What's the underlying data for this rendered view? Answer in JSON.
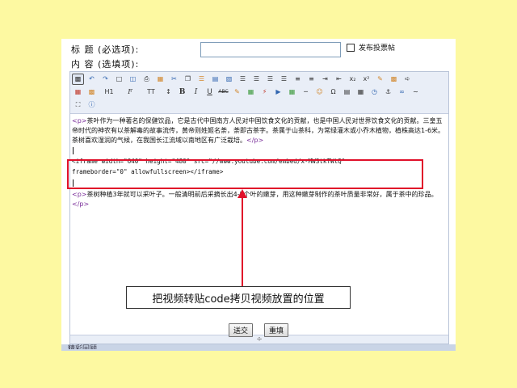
{
  "form": {
    "title_label": "标  题 (必选项):",
    "content_label": "内  容 (选填项):",
    "title_value": "",
    "poll_label": "发布投票帖"
  },
  "toolbar": {
    "row1": [
      "source",
      "undo",
      "redo",
      "new",
      "preview",
      "print",
      "template",
      "cut",
      "copy",
      "paste",
      "paste-text",
      "paste-word",
      "align-left",
      "align-center",
      "align-right",
      "justify",
      "ordered-list",
      "unordered-list",
      "indent",
      "outdent",
      "subscript",
      "superscript",
      "clear-format",
      "select-all",
      "select"
    ],
    "row2_text": {
      "h1": "H1",
      "font": "F",
      "size": "TT",
      "bold": "B",
      "italic": "I",
      "underline": "U",
      "strike": "ABC"
    },
    "row2_icons": [
      "text-color",
      "bg-color",
      "h1",
      "font-family",
      "font-size",
      "bold",
      "italic",
      "underline",
      "strikethrough",
      "line-height",
      "remove-format",
      "image",
      "flash",
      "media",
      "table",
      "hr",
      "emoticon",
      "special-char",
      "page-break",
      "date",
      "time",
      "anchor",
      "link",
      "unlink"
    ],
    "row3_icons": [
      "fullscreen",
      "about"
    ]
  },
  "editor": {
    "para1_open": "<p>",
    "para1_text": "茶叶作为一种著名的保健饮品，它是古代中国南方人民对中国饮食文化的贡献，也是中国人民对世界饮食文化的贡献。三皇五帝时代的神农有以茶解毒的故事流传，黄帝则姓姬名荼，荼即古茶字。茶属于山茶科，为常绿灌木或小乔木植物，植株高达1-6米。茶树喜欢湿润的气候，在我国长江流域以南地区有广泛栽培。",
    "para1_close": "</p>",
    "code_line1": "<iframe width=\"640\" height=\"480\" src=\"//www.youtube.com/embed/x-MWStkTWtQ\"",
    "code_line2": "frameborder=\"0\" allowfullscreen></iframe>",
    "para2_open": "<p>",
    "para2_text": "茶树种植3年就可以采叶子。一般清明前后采摘长出4-5个叶的嫩芽，用这种嫩芽制作的茶叶质量非常好，属于茶中的珍品。",
    "para2_close": "</p>",
    "resize_handle": "÷"
  },
  "buttons": {
    "submit": "送交",
    "reset": "重填"
  },
  "bottom_strip_text": "精彩回顾",
  "annotation": {
    "text": "把视频转贴code拷贝视频放置的位置"
  },
  "colors": {
    "page_bg": "#fdf9a1",
    "highlight": "#e0102a",
    "toolbar_bg": "#e9eef7"
  }
}
